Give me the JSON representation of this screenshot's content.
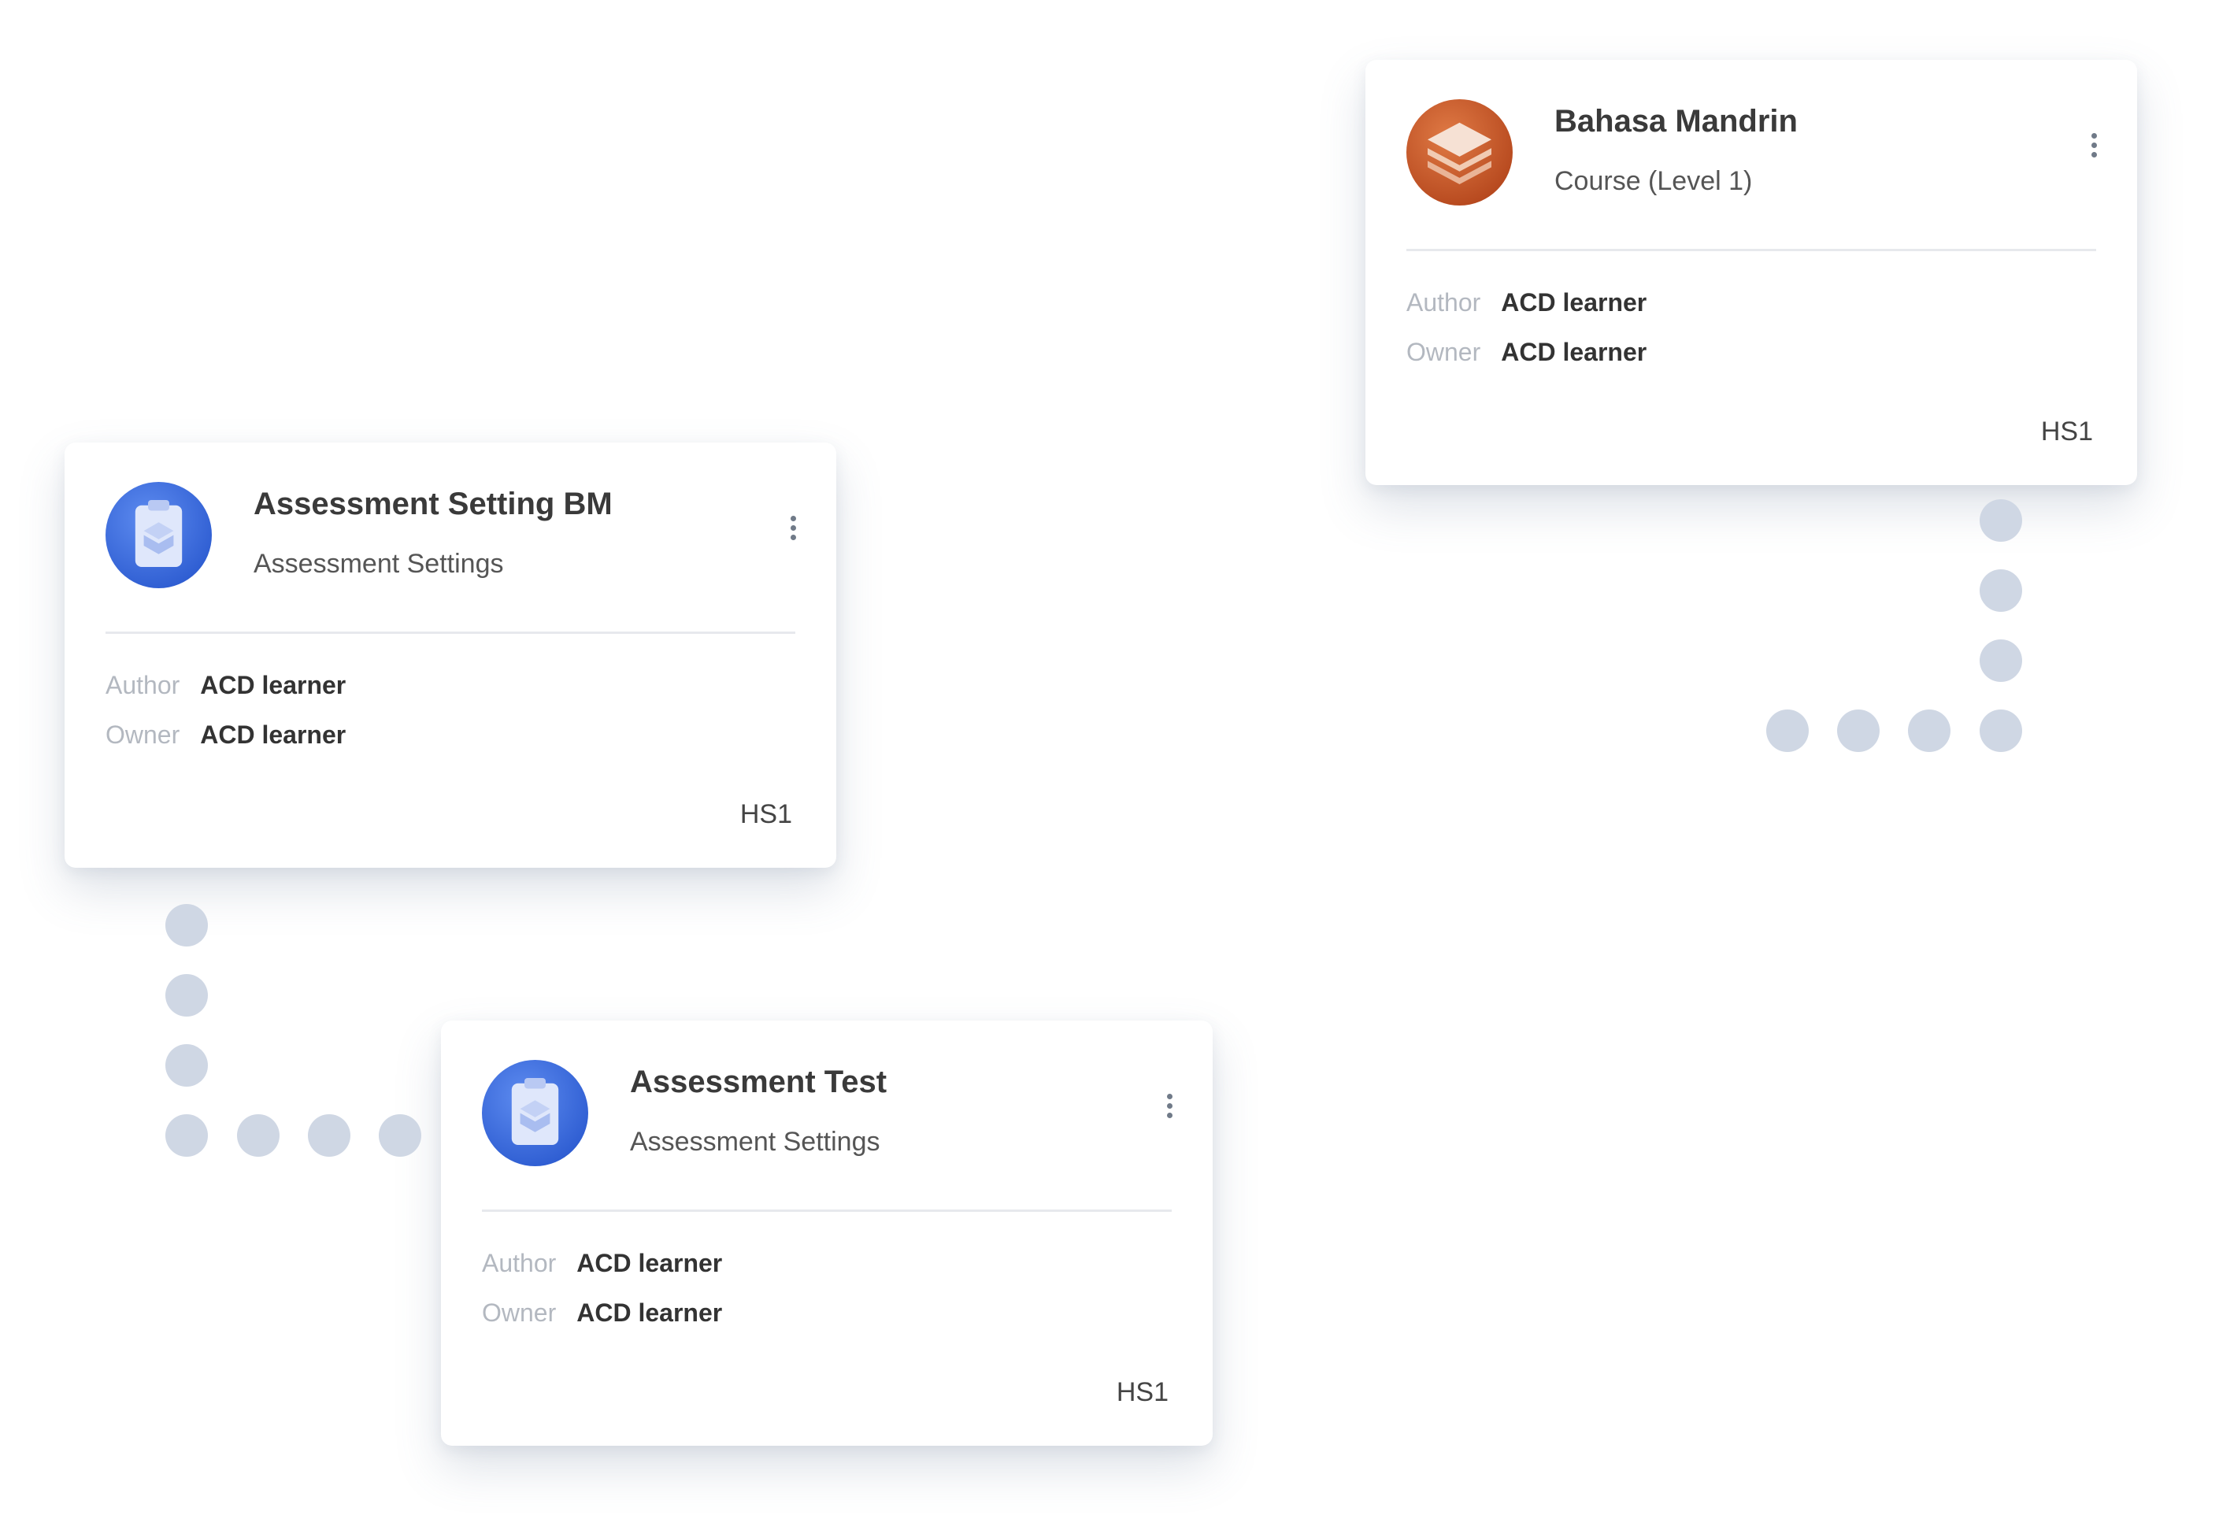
{
  "colors": {
    "dot": "#cfd7e4",
    "assessment_icon": "#3b6fe0",
    "course_icon": "#c8592b"
  },
  "cards": [
    {
      "title": "Bahasa Mandrin",
      "subtitle": "Course (Level 1)",
      "icon": "layers-icon",
      "author_label": "Author",
      "author": "ACD learner",
      "owner_label": "Owner",
      "owner": "ACD learner",
      "code": "HS1"
    },
    {
      "title": "Assessment Setting BM",
      "subtitle": "Assessment Settings",
      "icon": "clipboard-icon",
      "author_label": "Author",
      "author": "ACD learner",
      "owner_label": "Owner",
      "owner": "ACD learner",
      "code": "HS1"
    },
    {
      "title": "Assessment Test",
      "subtitle": "Assessment Settings",
      "icon": "clipboard-icon",
      "author_label": "Author",
      "author": "ACD learner",
      "owner_label": "Owner",
      "owner": "ACD learner",
      "code": "HS1"
    }
  ]
}
